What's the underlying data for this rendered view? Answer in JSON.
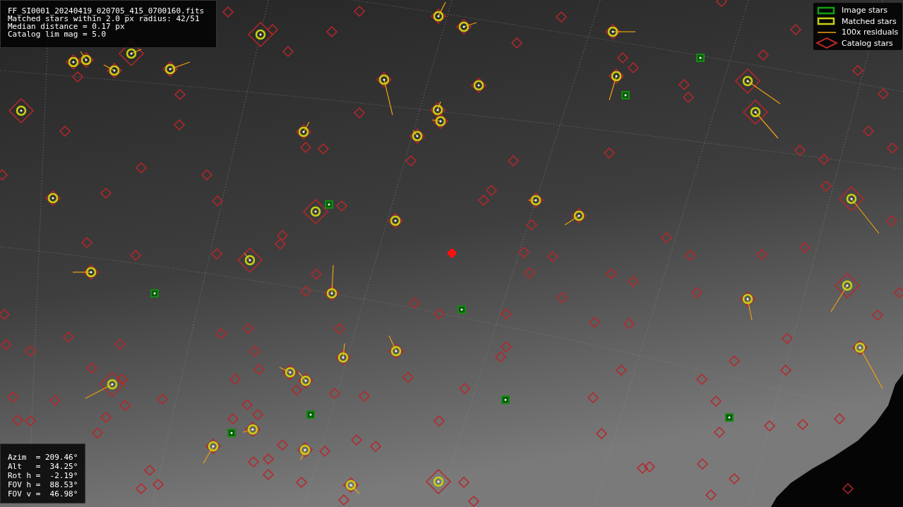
{
  "info": {
    "lines": [
      "FF_SI0001_20240419_020705_415_0700160.fits",
      "Matched stars within 2.0 px radius: 42/51",
      "Median distance = 0.17 px",
      "Catalog lim mag = 5.0"
    ]
  },
  "legend": [
    {
      "kind": "image",
      "label": "Image stars"
    },
    {
      "kind": "matched",
      "label": "Matched stars"
    },
    {
      "kind": "residual",
      "label": "100x residuals"
    },
    {
      "kind": "catalog",
      "label": "Catalog stars"
    }
  ],
  "pointing": {
    "lines": [
      "Azim  = 209.46°",
      "Alt   =  34.25°",
      "Rot h =  -2.19°",
      "FOV h =  88.53°",
      "FOV v =  46.98°"
    ]
  }
}
